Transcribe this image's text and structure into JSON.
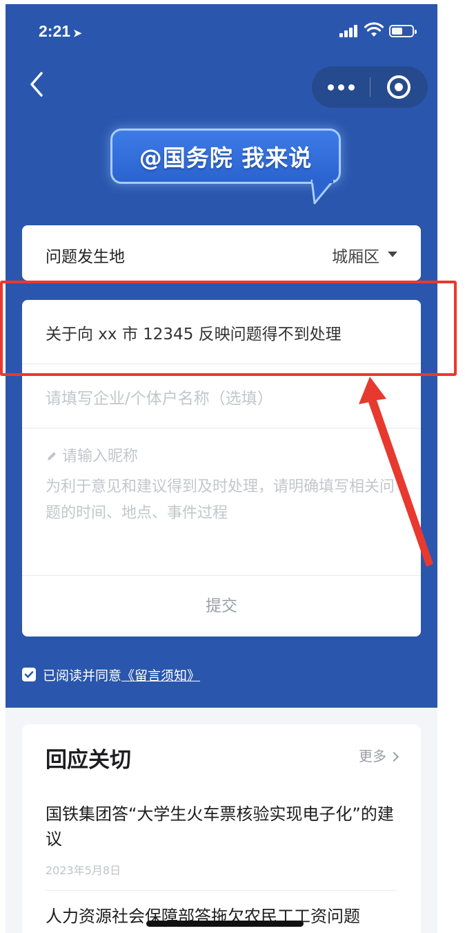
{
  "status_bar": {
    "time": "2:21",
    "location_glyph": "➤"
  },
  "nav": {
    "back_icon": "chevron-left-icon",
    "more_icon": "more-dots-icon",
    "close_icon": "target-circle-icon"
  },
  "banner": {
    "text": "@国务院 我来说"
  },
  "form": {
    "location_label": "问题发生地",
    "location_value": "城厢区",
    "title_value": "关于向 xx 市 12345 反映问题得不到处理",
    "company_placeholder": "请填写企业/个体户名称（选填）",
    "nickname_placeholder": "请输入昵称",
    "content_placeholder": "为利于意见和建议得到及时处理，请明确填写相关问题的时间、地点、事件过程",
    "submit_label": "提交"
  },
  "agreement": {
    "checked": true,
    "text": "已阅读并同意",
    "link": "《留言须知》"
  },
  "responses": {
    "title": "回应关切",
    "more_label": "更多",
    "items": [
      {
        "headline": "国铁集团答“大学生火车票核验实现电子化”的建议",
        "date": "2023年5月8日"
      },
      {
        "headline": "人力资源社会保障部答拖欠农民工工资问题",
        "date": ""
      }
    ]
  },
  "colors": {
    "primary_blue": "#2a57ad",
    "annotation_red": "#e8392f",
    "page_bg": "#f3f5f9"
  }
}
